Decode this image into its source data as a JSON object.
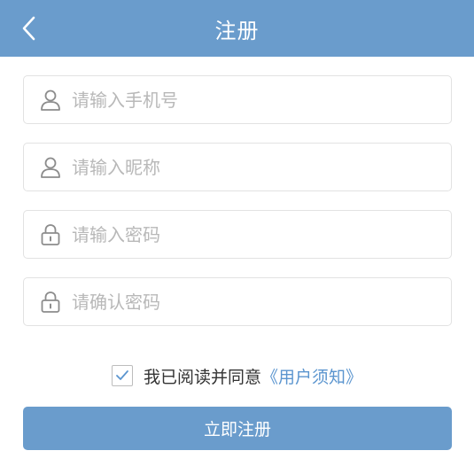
{
  "header": {
    "title": "注册",
    "back_icon": "chevron-left-icon",
    "background": "#6a9ccc"
  },
  "form": {
    "phone": {
      "placeholder": "请输入手机号",
      "value": "",
      "icon": "user-icon"
    },
    "nickname": {
      "placeholder": "请输入昵称",
      "value": "",
      "icon": "user-icon"
    },
    "password": {
      "placeholder": "请输入密码",
      "value": "",
      "icon": "lock-icon"
    },
    "confirm_password": {
      "placeholder": "请确认密码",
      "value": "",
      "icon": "lock-icon"
    }
  },
  "agreement": {
    "checked": true,
    "text": "我已阅读并同意",
    "link": "《用户须知》",
    "link_color": "#5b95cf"
  },
  "submit": {
    "label": "立即注册",
    "background": "#6a9ccc"
  }
}
